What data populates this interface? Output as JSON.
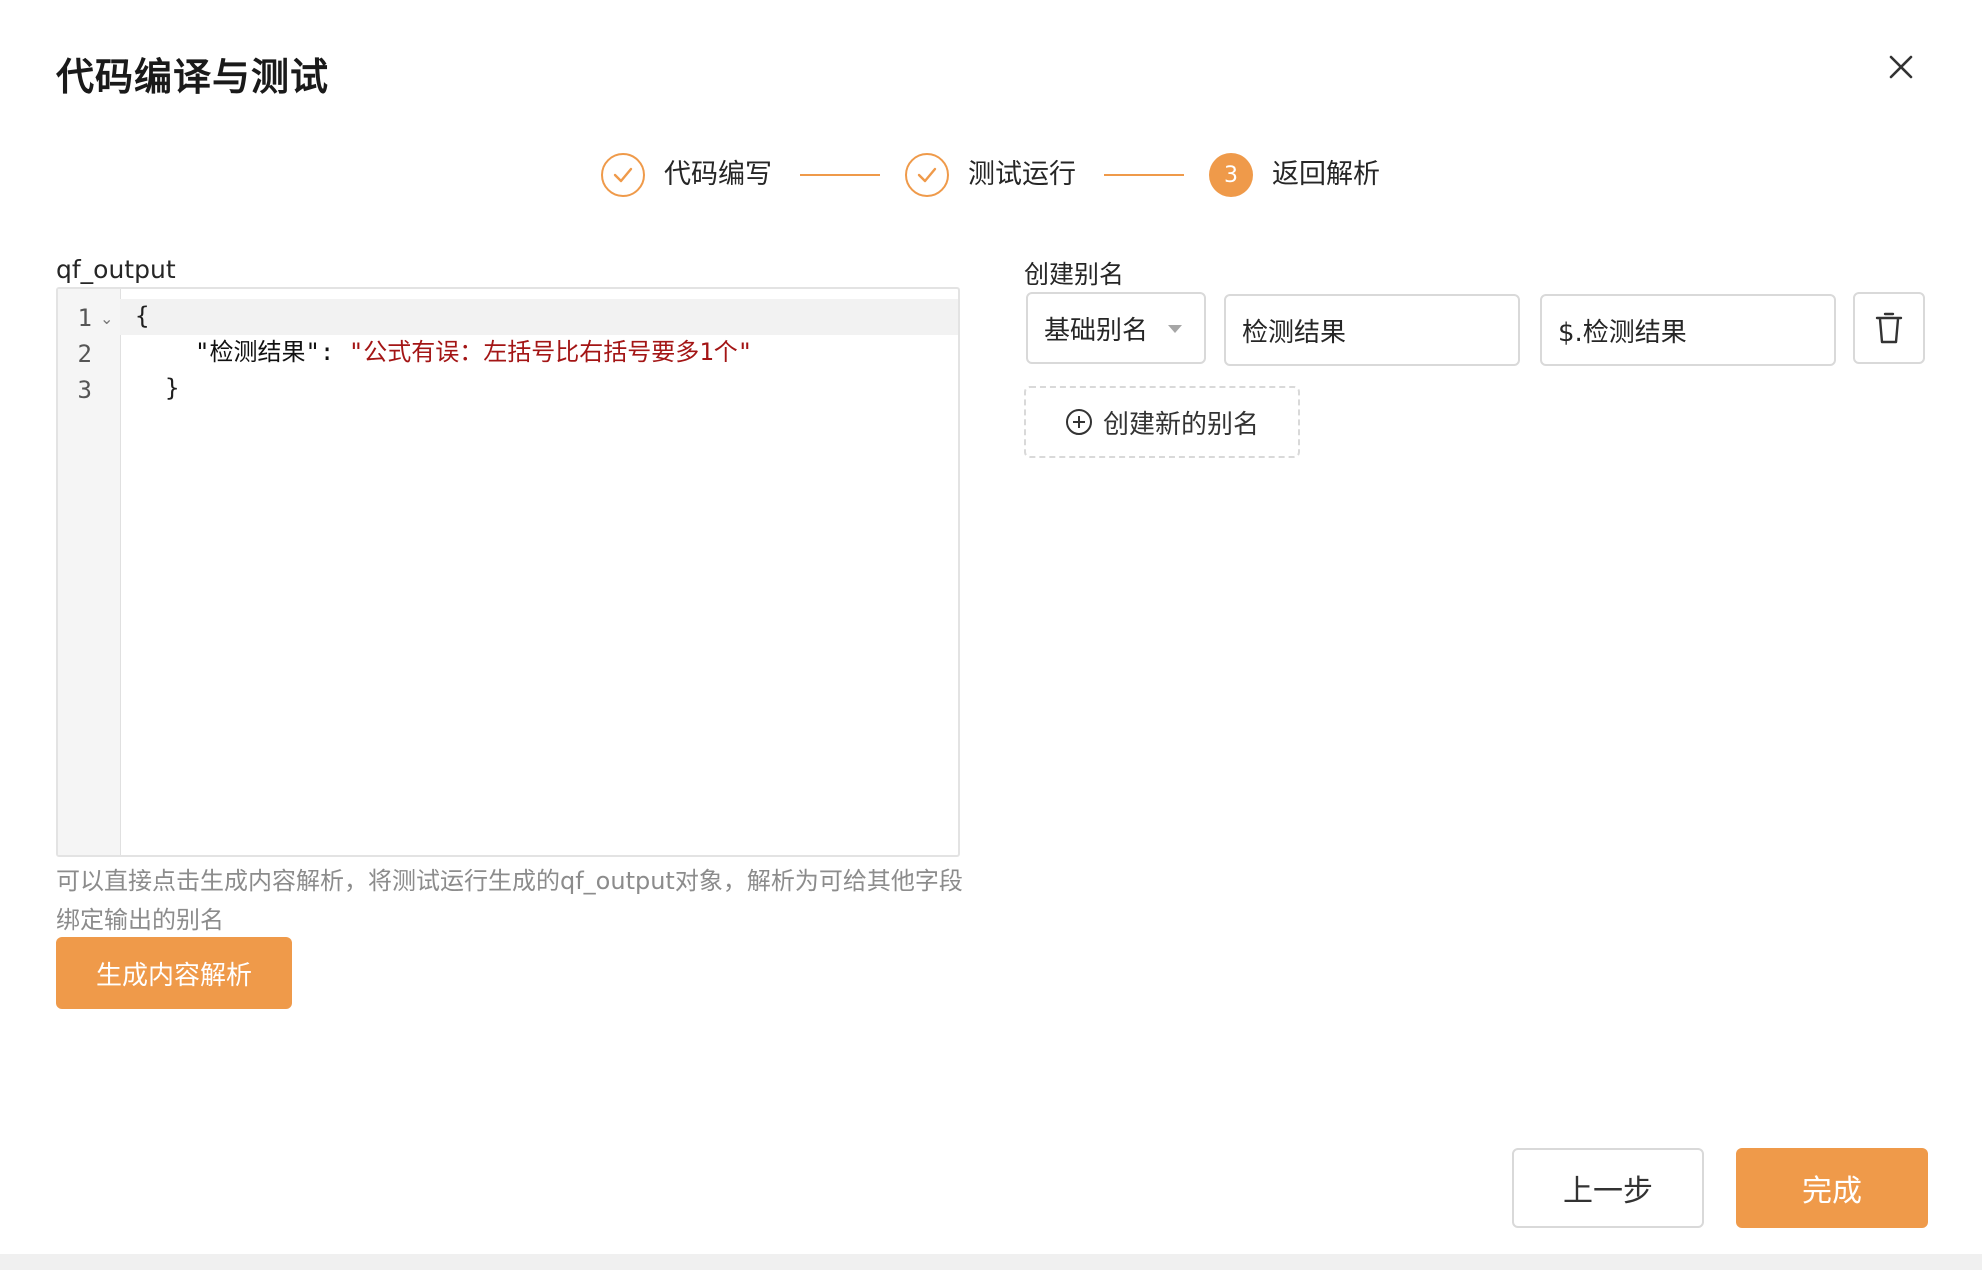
{
  "dialog": {
    "title": "代码编译与测试",
    "close_icon": "close-icon"
  },
  "steps": [
    {
      "label": "代码编写",
      "status": "done",
      "icon": "check-icon"
    },
    {
      "label": "测试运行",
      "status": "done",
      "icon": "check-icon"
    },
    {
      "label": "返回解析",
      "status": "active",
      "number": "3"
    }
  ],
  "editor": {
    "label": "qf_output",
    "line_numbers": [
      "1",
      "2",
      "3"
    ],
    "lines": [
      {
        "text": "{"
      },
      {
        "key": "\"检测结果\"",
        "sep": ": ",
        "value": "\"公式有误：左括号比右括号要多1个\""
      },
      {
        "text": "}"
      }
    ],
    "fold_icon": "chevron-down-icon"
  },
  "hint": "可以直接点击生成内容解析，将测试运行生成的qf_output对象，解析为可给其他字段绑定输出的别名",
  "generate_button": "生成内容解析",
  "alias": {
    "label": "创建别名",
    "rows": [
      {
        "type_select": "基础别名",
        "name": "检测结果",
        "path": "$.检测结果",
        "delete_icon": "trash-icon"
      }
    ],
    "add_button": "创建新的别名",
    "add_icon": "plus-circle-icon"
  },
  "footer": {
    "prev_button": "上一步",
    "finish_button": "完成"
  },
  "colors": {
    "accent": "#ef9a4a",
    "string": "#a31515",
    "hint": "#8c8c8c",
    "border": "#d9d9d9"
  }
}
